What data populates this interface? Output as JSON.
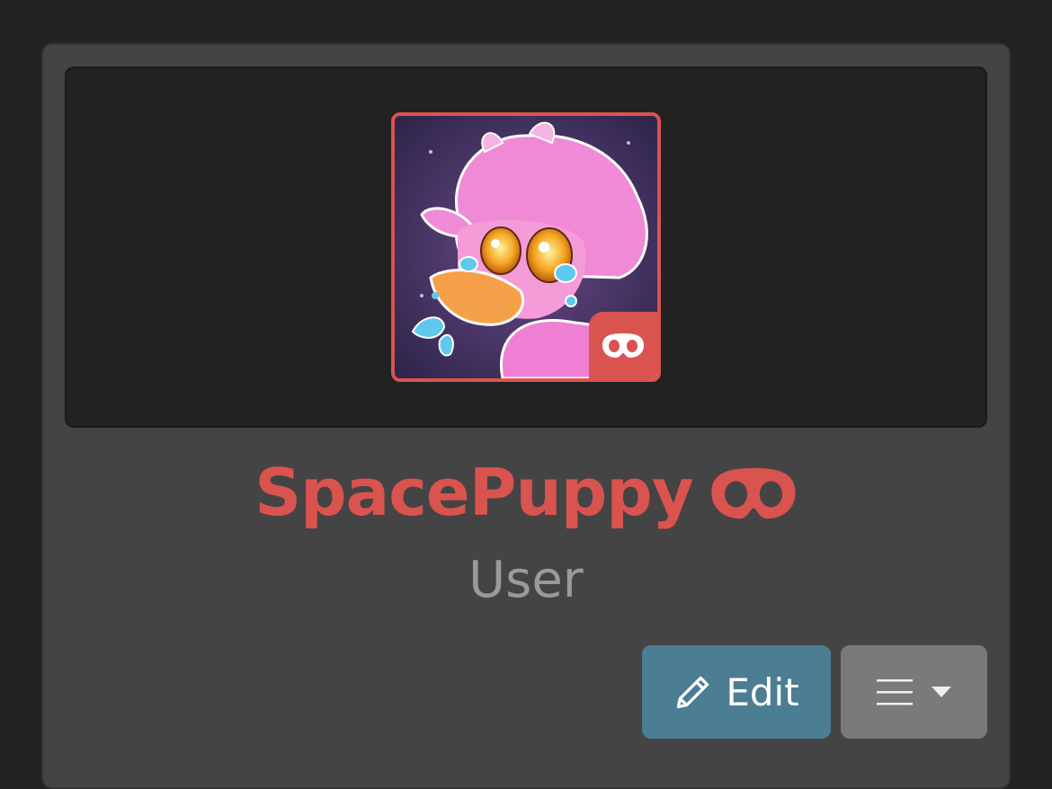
{
  "profile": {
    "username": "SpacePuppy",
    "role": "User",
    "avatar_badge_icon": "mask-icon",
    "name_badge_icon": "mask-icon"
  },
  "actions": {
    "edit_label": "Edit",
    "edit_icon": "pencil-icon",
    "menu_icon": "hamburger-icon",
    "menu_caret_icon": "caret-down-icon"
  },
  "colors": {
    "accent": "#d9534f",
    "edit_button": "#4b7d93",
    "menu_button": "#7a7a7a",
    "card_bg": "#444444",
    "page_bg": "#222222",
    "role_text": "#9a9a9a"
  }
}
